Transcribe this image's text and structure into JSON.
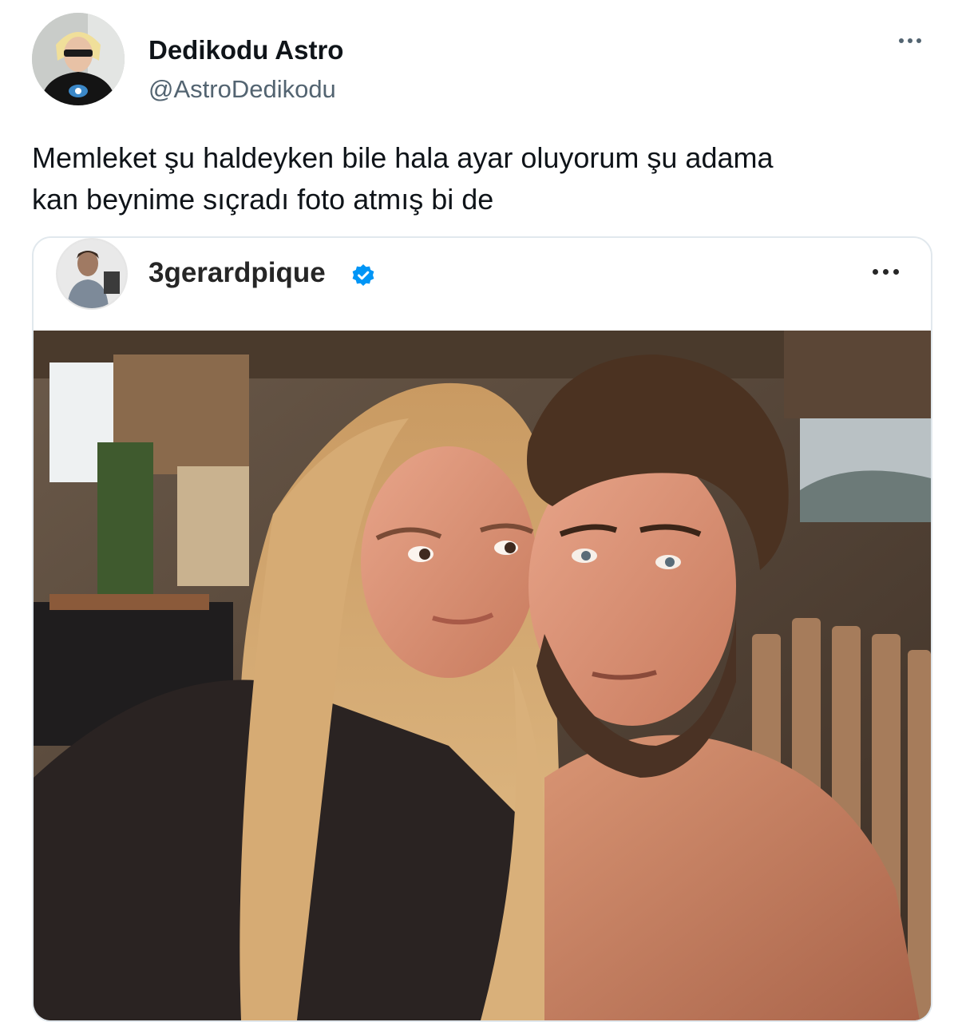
{
  "tweet": {
    "author": {
      "display_name": "Dedikodu Astro",
      "handle": "@AstroDedikodu"
    },
    "text_lines": [
      "Memleket şu haldeyken bile hala ayar oluyorum şu adama",
      "kan beynime sıçradı foto atmış bi de"
    ],
    "more_icon": "more-horizontal-icon"
  },
  "embedded_post": {
    "username": "3gerardpique",
    "verified": true,
    "verified_color": "#0095f6",
    "more_icon": "more-horizontal-icon",
    "photo_description_icon": "selfie-photo"
  },
  "colors": {
    "text_primary": "#0f1419",
    "text_secondary": "#536471",
    "card_border": "#e1e8ed"
  }
}
